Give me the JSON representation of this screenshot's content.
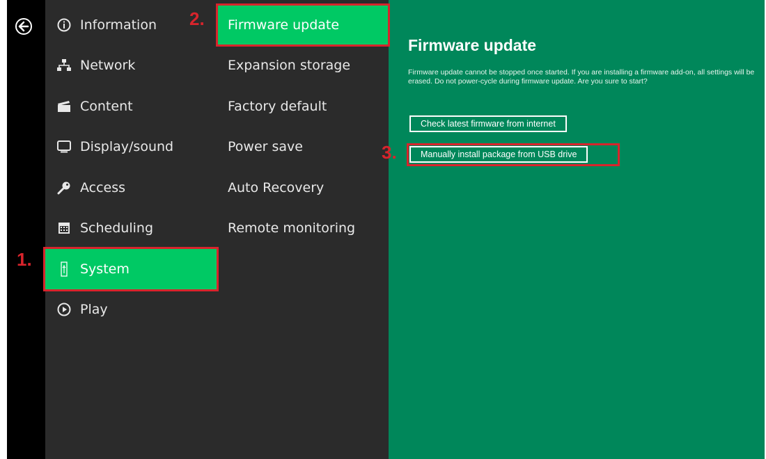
{
  "main_menu": {
    "items": [
      {
        "label": "Information",
        "icon": "info-icon"
      },
      {
        "label": "Network",
        "icon": "network-icon"
      },
      {
        "label": "Content",
        "icon": "clapperboard-icon"
      },
      {
        "label": "Display/sound",
        "icon": "monitor-icon"
      },
      {
        "label": "Access",
        "icon": "key-icon"
      },
      {
        "label": "Scheduling",
        "icon": "calendar-icon"
      },
      {
        "label": "System",
        "icon": "usb-icon"
      },
      {
        "label": "Play",
        "icon": "play-icon"
      }
    ],
    "active": "System"
  },
  "sub_menu": {
    "items": [
      {
        "label": "Firmware update"
      },
      {
        "label": "Expansion storage"
      },
      {
        "label": "Factory default"
      },
      {
        "label": "Power save"
      },
      {
        "label": "Auto Recovery"
      },
      {
        "label": "Remote monitoring"
      }
    ],
    "active": "Firmware update"
  },
  "content": {
    "title": "Firmware update",
    "description": "Firmware update cannot be stopped once started. If you are installing a firmware add-on, all settings will be erased. Do not power-cycle during firmware update. Are you sure to start?",
    "buttons": [
      {
        "label": "Check latest firmware from internet"
      },
      {
        "label": "Manually install package from USB drive"
      }
    ]
  },
  "annotations": {
    "step1": "1.",
    "step2": "2.",
    "step3": "3."
  },
  "colors": {
    "accent_green": "#00c964",
    "panel_green": "#00875a",
    "menu_bg": "#2b2b2b",
    "highlight_red": "#d8242c"
  }
}
